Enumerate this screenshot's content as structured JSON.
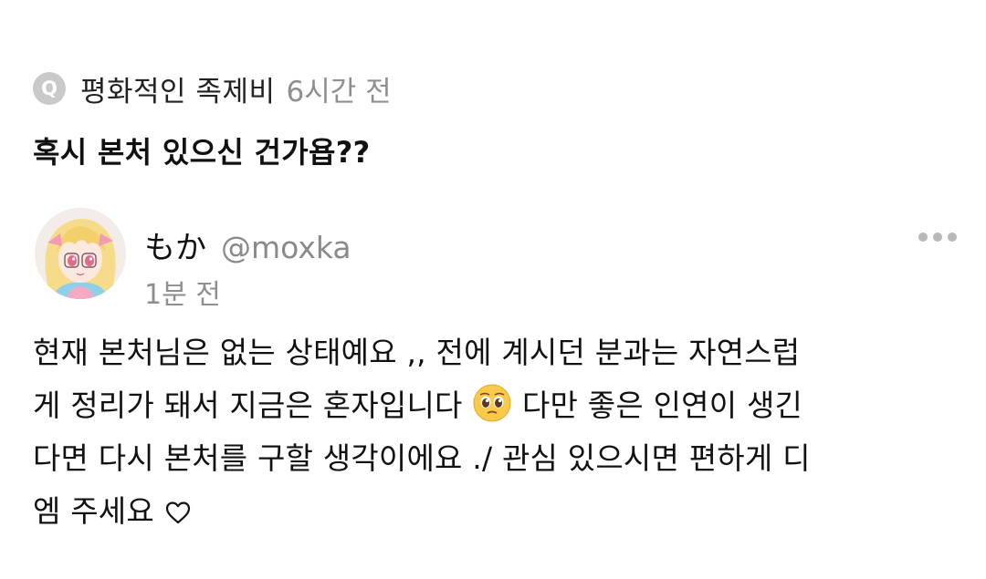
{
  "question": {
    "badge_letter": "Q",
    "asker_name": "평화적인 족제비",
    "time": "6시간 전",
    "text": "혹시 본처 있으신 건가욥??"
  },
  "answer": {
    "display_name": "もか",
    "handle": "@moxka",
    "time": "1분 전",
    "avatar_icon": "anime-avatar-image",
    "more_icon": "more-dots-icon",
    "lines": [
      {
        "text": "현재 본처님은 없는 상태예요 ,, 전에 계시던 분과는 자연스럽"
      },
      {
        "before": "게 정리가 돼서 지금은 혼자입니다 ",
        "emoji": "pleading-face-emoji",
        "after": " 다만 좋은 인연이 생긴"
      },
      {
        "text": "다면 다시 본처를 구할 생각이에요 ./ 관심 있으시면 편하게 디"
      },
      {
        "before": "엠 주세요 ",
        "emoji": "heart-outline-icon"
      }
    ]
  },
  "colors": {
    "badge": "#c9c9c9",
    "muted_text": "#8f8f8f",
    "primary_text": "#111111",
    "more_dots": "#b8b8b8",
    "background": "#ffffff"
  }
}
